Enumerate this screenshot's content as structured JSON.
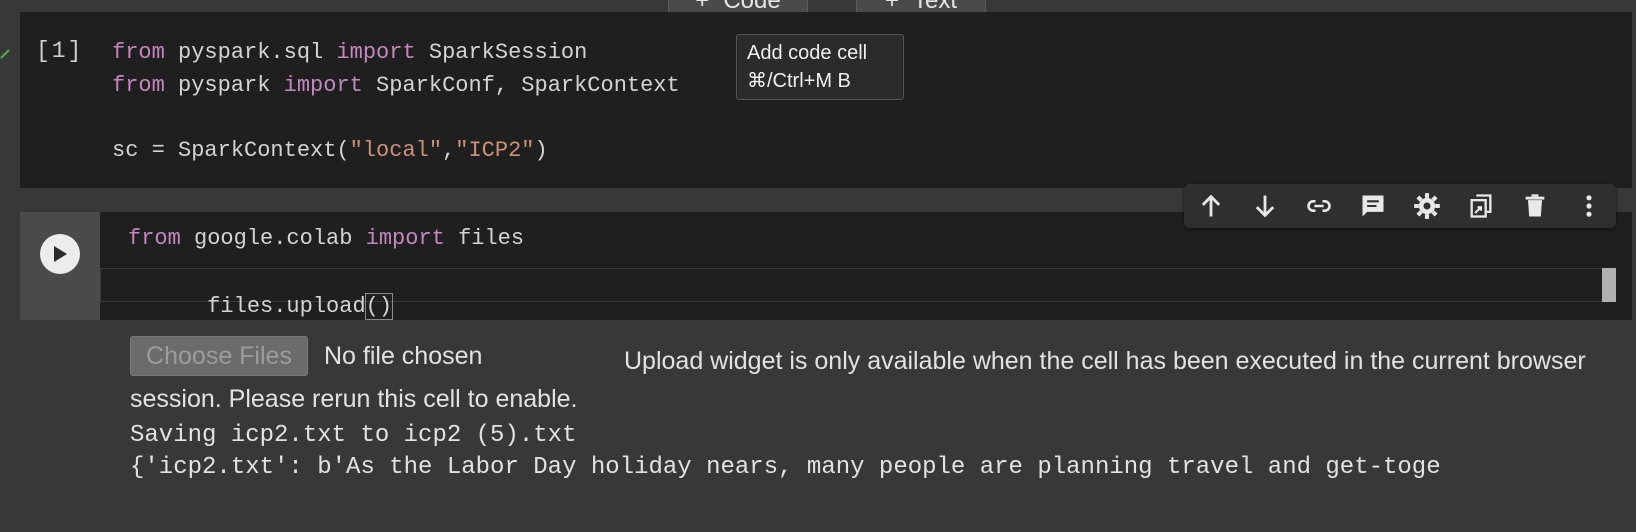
{
  "toolbar_top": {
    "code_label": "Code",
    "text_label": "Text",
    "plus": "+"
  },
  "cell1": {
    "exec_count": "[1]",
    "lines": [
      [
        {
          "t": "from",
          "c": "kw"
        },
        {
          "t": " pyspark.sql ",
          "c": "plain"
        },
        {
          "t": "import",
          "c": "kw"
        },
        {
          "t": " SparkSession",
          "c": "plain"
        }
      ],
      [
        {
          "t": "from",
          "c": "kw"
        },
        {
          "t": " pyspark ",
          "c": "plain"
        },
        {
          "t": "import",
          "c": "kw"
        },
        {
          "t": " SparkConf, SparkContext",
          "c": "plain"
        }
      ],
      [],
      [
        {
          "t": "sc = SparkContext(",
          "c": "plain"
        },
        {
          "t": "\"local\"",
          "c": "str"
        },
        {
          "t": ",",
          "c": "plain"
        },
        {
          "t": "\"ICP2\"",
          "c": "str"
        },
        {
          "t": ")",
          "c": "plain"
        }
      ]
    ]
  },
  "tooltip": {
    "title": "Add code cell",
    "shortcut": "⌘/Ctrl+M B"
  },
  "cell_toolbar": {
    "icons": [
      "arrow-up-icon",
      "arrow-down-icon",
      "link-icon",
      "comment-icon",
      "gear-icon",
      "mirror-cell-icon",
      "trash-icon",
      "more-vert-icon"
    ]
  },
  "cell2": {
    "line1": [
      {
        "t": "from",
        "c": "kw"
      },
      {
        "t": " google.colab ",
        "c": "plain"
      },
      {
        "t": "import",
        "c": "kw"
      },
      {
        "t": " files",
        "c": "plain"
      }
    ],
    "line2_prefix": "files.upload",
    "line2_parens": "()"
  },
  "output": {
    "choose_files": "Choose Files",
    "no_file": "No file chosen",
    "upload_msg": "Upload widget is only available when the cell has been executed in the current browser session. Please rerun this cell to enable.",
    "saving_line": "Saving icp2.txt to icp2 (5).txt",
    "dict_line": "{'icp2.txt': b'As the Labor Day holiday nears, many people are planning travel and get-toge"
  }
}
